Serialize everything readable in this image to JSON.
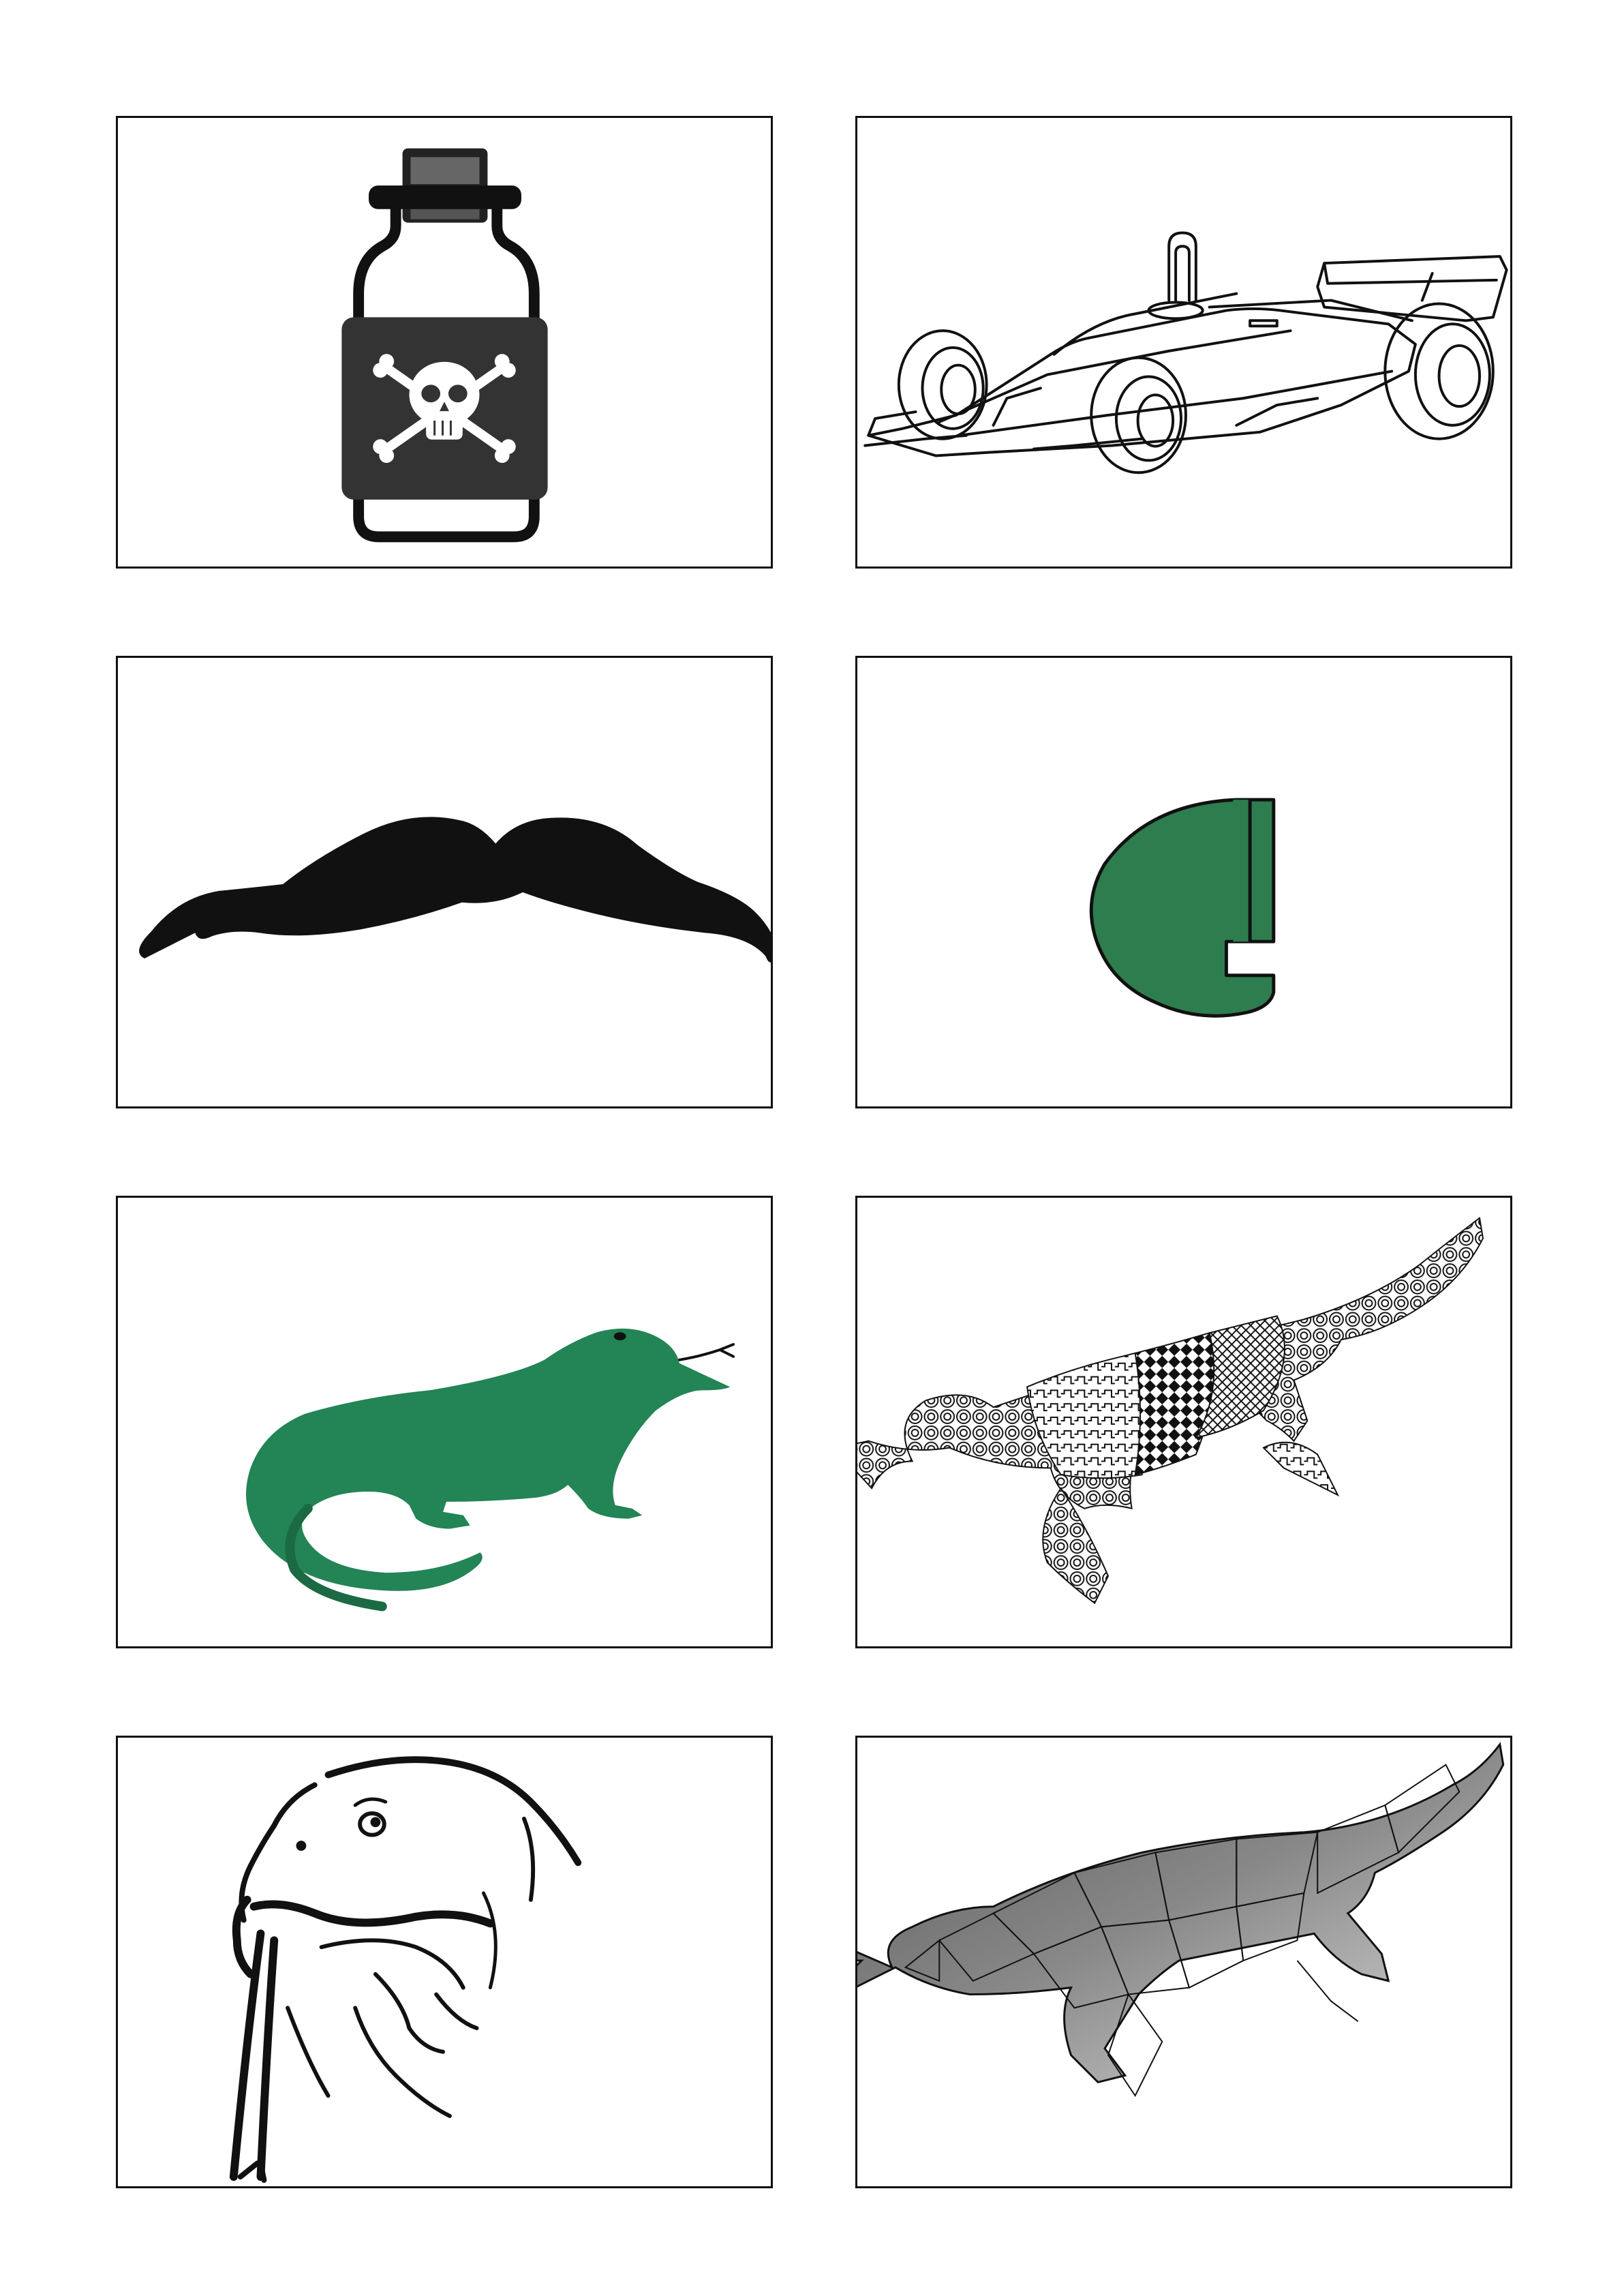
{
  "cards": [
    {
      "icon": "poison-bottle-icon"
    },
    {
      "icon": "race-car-icon"
    },
    {
      "icon": "mustache-icon"
    },
    {
      "icon": "letter-g-fragment-icon"
    },
    {
      "icon": "green-lizard-icon"
    },
    {
      "icon": "patterned-lizard-icon"
    },
    {
      "icon": "lizard-head-sketch-icon"
    },
    {
      "icon": "polygon-lizard-icon"
    }
  ],
  "colors": {
    "border": "#111111",
    "green": "#2e7d4f",
    "lizard_green": "#238456",
    "black": "#111111"
  }
}
